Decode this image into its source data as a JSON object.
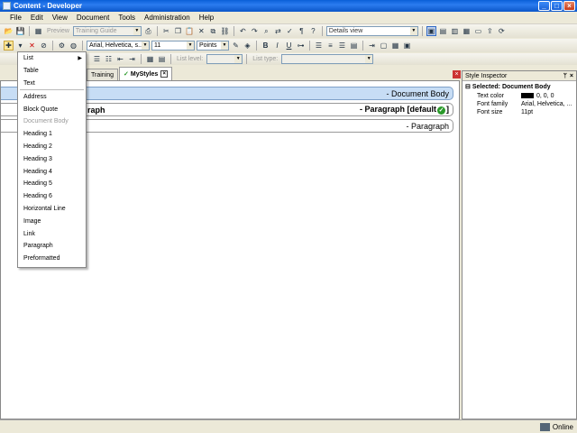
{
  "window": {
    "title": "Content - Developer"
  },
  "menu": [
    "File",
    "Edit",
    "View",
    "Document",
    "Tools",
    "Administration",
    "Help"
  ],
  "toolbar1": {
    "preview_label": "Preview",
    "guide_combo": "Training Guide",
    "view_combo": "Details view"
  },
  "toolbar2": {
    "font_combo": "Arial, Helvetica, s...",
    "size_combo": "11",
    "unit_combo": "Points",
    "bold": "B",
    "italic": "I",
    "underline": "U"
  },
  "toolbar3": {
    "list_level_label": "List level:",
    "list_type_label": "List type:"
  },
  "tabs": [
    {
      "label": "Training"
    },
    {
      "label": "MyStyles"
    }
  ],
  "editor": {
    "rows": [
      {
        "left": "",
        "right": "- Document Body"
      },
      {
        "left": "raph",
        "right": "- Paragraph [default"
      },
      {
        "left": "",
        "right": "- Paragraph"
      }
    ]
  },
  "dropdown": {
    "group1": [
      {
        "label": "List",
        "sub": true
      },
      {
        "label": "Table"
      },
      {
        "label": "Text"
      }
    ],
    "group2": [
      {
        "label": "Address"
      },
      {
        "label": "Block Quote"
      },
      {
        "label": "Document Body",
        "disabled": true
      },
      {
        "label": "Heading 1"
      },
      {
        "label": "Heading 2"
      },
      {
        "label": "Heading 3"
      },
      {
        "label": "Heading 4"
      },
      {
        "label": "Heading 5"
      },
      {
        "label": "Heading 6"
      },
      {
        "label": "Horizontal Line"
      },
      {
        "label": "Image"
      },
      {
        "label": "Link"
      },
      {
        "label": "Paragraph"
      },
      {
        "label": "Preformatted"
      }
    ]
  },
  "inspector": {
    "title": "Style Inspector",
    "selected": "Selected: Document Body",
    "props": [
      {
        "key": "Text color",
        "value": "0, 0, 0",
        "swatch": "#000000"
      },
      {
        "key": "Font family",
        "value": "Arial, Helvetica, ..."
      },
      {
        "key": "Font size",
        "value": "11pt"
      }
    ]
  },
  "status": {
    "text": "Online"
  },
  "colors": {
    "title_bar": "#0b56c9",
    "selected_row": "#c7ddf5",
    "check": "#2a9a2a"
  }
}
